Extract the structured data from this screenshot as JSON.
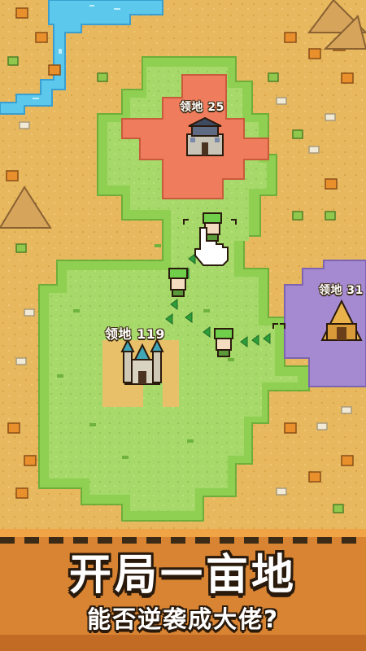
{
  "territories": {
    "red": {
      "label": "领地 25",
      "color": "#ef7c5d"
    },
    "green": {
      "label": "领地 119",
      "color": "#a6d86a"
    },
    "purple": {
      "label": "领地 31",
      "color": "#a58ad2"
    }
  },
  "banner": {
    "title": "开局一亩地",
    "subtitle": "能否逆袭成大佬?"
  },
  "colors": {
    "sand": "#e7b85e",
    "grass": "#9fd561",
    "water": "#5cc8ec",
    "outline": "#2a1a0c"
  },
  "icons": [
    "pointing-hand-icon",
    "castle-icon",
    "palace-icon",
    "temple-icon",
    "soldier-icon"
  ]
}
